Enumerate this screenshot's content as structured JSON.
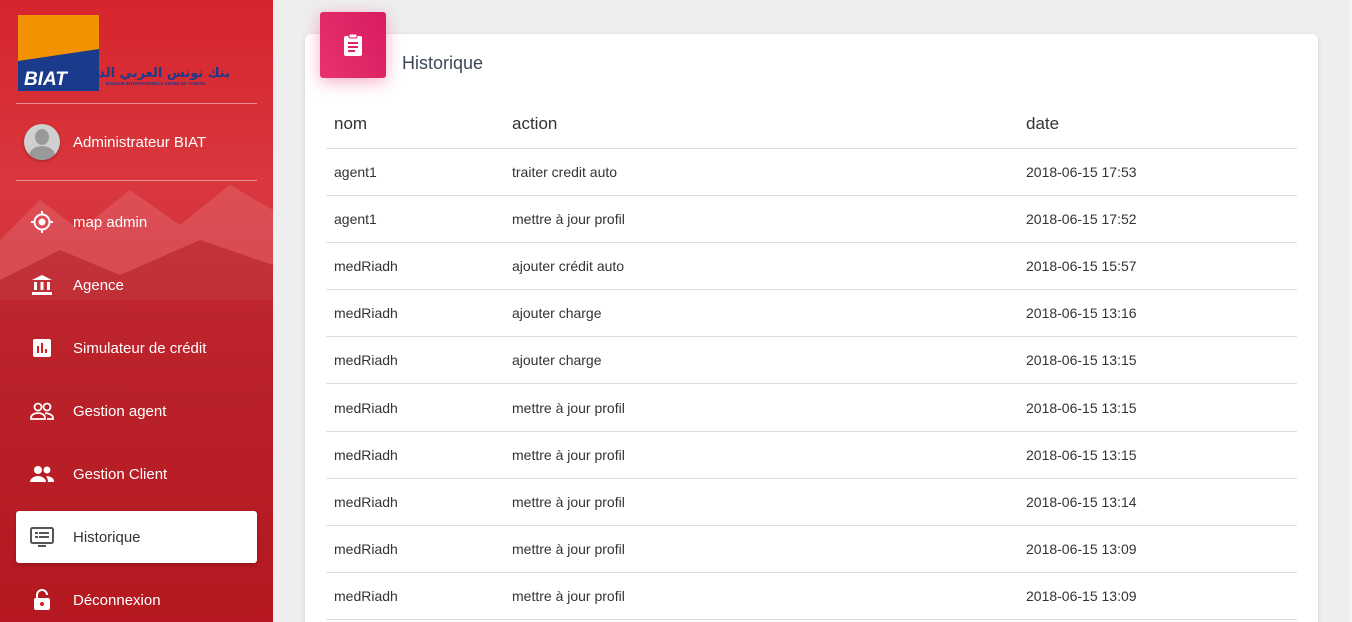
{
  "brand": {
    "logo_text": "BIAT",
    "logo_arabic": "بنك تونس العربي الدولي",
    "logo_subtitle": "BANQUE INTERNATIONALE ARABE DE TUNISIE"
  },
  "user": {
    "name": "Administrateur BIAT"
  },
  "nav": [
    {
      "label": "map admin",
      "icon": "location-icon"
    },
    {
      "label": "Agence",
      "icon": "bank-icon"
    },
    {
      "label": "Simulateur de crédit",
      "icon": "chart-icon"
    },
    {
      "label": "Gestion agent",
      "icon": "people-outline-icon"
    },
    {
      "label": "Gestion Client",
      "icon": "people-icon"
    },
    {
      "label": "Historique",
      "icon": "monitor-icon",
      "active": true
    },
    {
      "label": "Déconnexion",
      "icon": "lock-icon"
    }
  ],
  "card": {
    "title": "Historique",
    "icon": "clipboard-icon",
    "accent": "#e91e63"
  },
  "table": {
    "headers": [
      "nom",
      "action",
      "date"
    ],
    "rows": [
      [
        "agent1",
        "traiter credit auto",
        "2018-06-15 17:53"
      ],
      [
        "agent1",
        "mettre à jour profil",
        "2018-06-15 17:52"
      ],
      [
        "medRiadh",
        "ajouter crédit auto",
        "2018-06-15 15:57"
      ],
      [
        "medRiadh",
        "ajouter charge",
        "2018-06-15 13:16"
      ],
      [
        "medRiadh",
        "ajouter charge",
        "2018-06-15 13:15"
      ],
      [
        "medRiadh",
        "mettre à jour profil",
        "2018-06-15 13:15"
      ],
      [
        "medRiadh",
        "mettre à jour profil",
        "2018-06-15 13:15"
      ],
      [
        "medRiadh",
        "mettre à jour profil",
        "2018-06-15 13:14"
      ],
      [
        "medRiadh",
        "mettre à jour profil",
        "2018-06-15 13:09"
      ],
      [
        "medRiadh",
        "mettre à jour profil",
        "2018-06-15 13:09"
      ]
    ]
  },
  "colors": {
    "sidebar": "#d61e26",
    "accent": "#e91e63"
  }
}
